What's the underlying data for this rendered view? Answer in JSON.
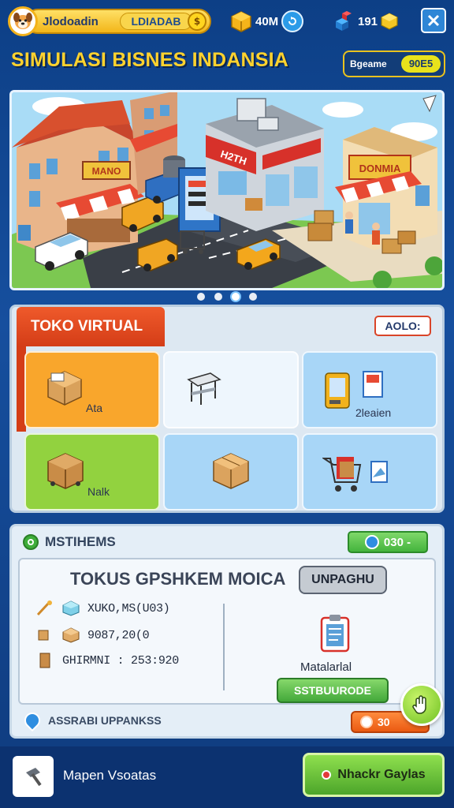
{
  "top_bar": {
    "player_name": "Jlodoadin",
    "player_level": "LDIADAB",
    "coin_symbol": "$",
    "resource_box_value": "40M",
    "resource_gem_value": "191"
  },
  "header": {
    "title": "SIMULASI BISNES INDANSIA",
    "currency_label": "Bgeame",
    "currency_value": "90E5"
  },
  "banner": {
    "shop_signs": [
      "MANO",
      "H2TH",
      "DONMIA"
    ],
    "slides_total": 4,
    "active_slide": 3
  },
  "store": {
    "tab_label": "TOKO VIRTUAL",
    "code": "AOLO:",
    "tiles": [
      {
        "label": "Ata",
        "icon": "box-icon",
        "color": "#f9a62c"
      },
      {
        "label": "",
        "icon": "stall-icon",
        "color": "#eef6fd"
      },
      {
        "label": "2leaien",
        "icon": "vending-icon",
        "color": "#a8d6f7"
      },
      {
        "label": "Nalk",
        "icon": "crate-icon",
        "color": "#92d23f"
      },
      {
        "label": "",
        "icon": "package-icon",
        "color": "#a8d6f7"
      },
      {
        "label": "",
        "icon": "cart-icon",
        "color": "#a8d6f7"
      }
    ]
  },
  "missions": {
    "title": "MSTIHEMS",
    "reward": "030 -",
    "card": {
      "title": "TOKUS GPSHKEM MOICA",
      "badge": "UNPAGHU",
      "stats": [
        "XUKO,MS(U03)",
        "9087,20(0",
        "GHIRMNI : 253:920"
      ],
      "item_label": "Matalarlal",
      "action_label": "SSTBUURODE"
    },
    "footer_text": "ASSRABI UPPANKSS",
    "footer_value": "30"
  },
  "bottom_bar": {
    "left_label": "Mapen Vsoatas",
    "right_label": "Nhackr Gaylas"
  }
}
